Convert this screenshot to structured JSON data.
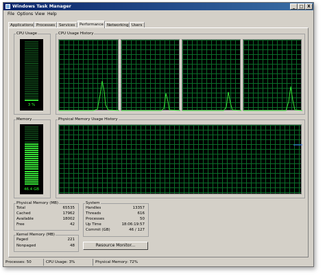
{
  "window": {
    "title": "Windows Task Manager",
    "buttons": [
      "_",
      "□",
      "X"
    ]
  },
  "menu": [
    "File",
    "Options",
    "View",
    "Help"
  ],
  "tabs": [
    "Applications",
    "Processes",
    "Services",
    "Performance",
    "Networking",
    "Users"
  ],
  "active_tab": "Performance",
  "cpu": {
    "label": "CPU Usage",
    "value": "3 %",
    "history_label": "CPU Usage History",
    "fraction": 0.03
  },
  "memory": {
    "label": "Memory",
    "value": "46.4 GB",
    "history_label": "Physical Memory Usage History",
    "fraction": 0.72
  },
  "physical_memory": {
    "title": "Physical Memory (MB)",
    "rows": [
      {
        "k": "Total",
        "v": "65535"
      },
      {
        "k": "Cached",
        "v": "17962"
      },
      {
        "k": "Available",
        "v": "18002"
      },
      {
        "k": "Free",
        "v": "42"
      }
    ]
  },
  "kernel_memory": {
    "title": "Kernel Memory (MB)",
    "rows": [
      {
        "k": "Paged",
        "v": "221"
      },
      {
        "k": "Nonpaged",
        "v": "48"
      }
    ]
  },
  "system": {
    "title": "System",
    "rows": [
      {
        "k": "Handles",
        "v": "13357"
      },
      {
        "k": "Threads",
        "v": "616"
      },
      {
        "k": "Processes",
        "v": "50"
      },
      {
        "k": "Up Time",
        "v": "18:06:19:57"
      },
      {
        "k": "Commit (GB)",
        "v": "46 / 127"
      }
    ]
  },
  "resource_monitor_button": "Resource Monitor...",
  "status": {
    "processes": "Processes: 50",
    "cpu": "CPU Usage: 3%",
    "memory": "Physical Memory: 72%"
  },
  "colors": {
    "graph_line": "#35e035",
    "grid": "#0b6e2a",
    "memory_line": "#3a7bff",
    "title_bar": "#0a246a"
  }
}
